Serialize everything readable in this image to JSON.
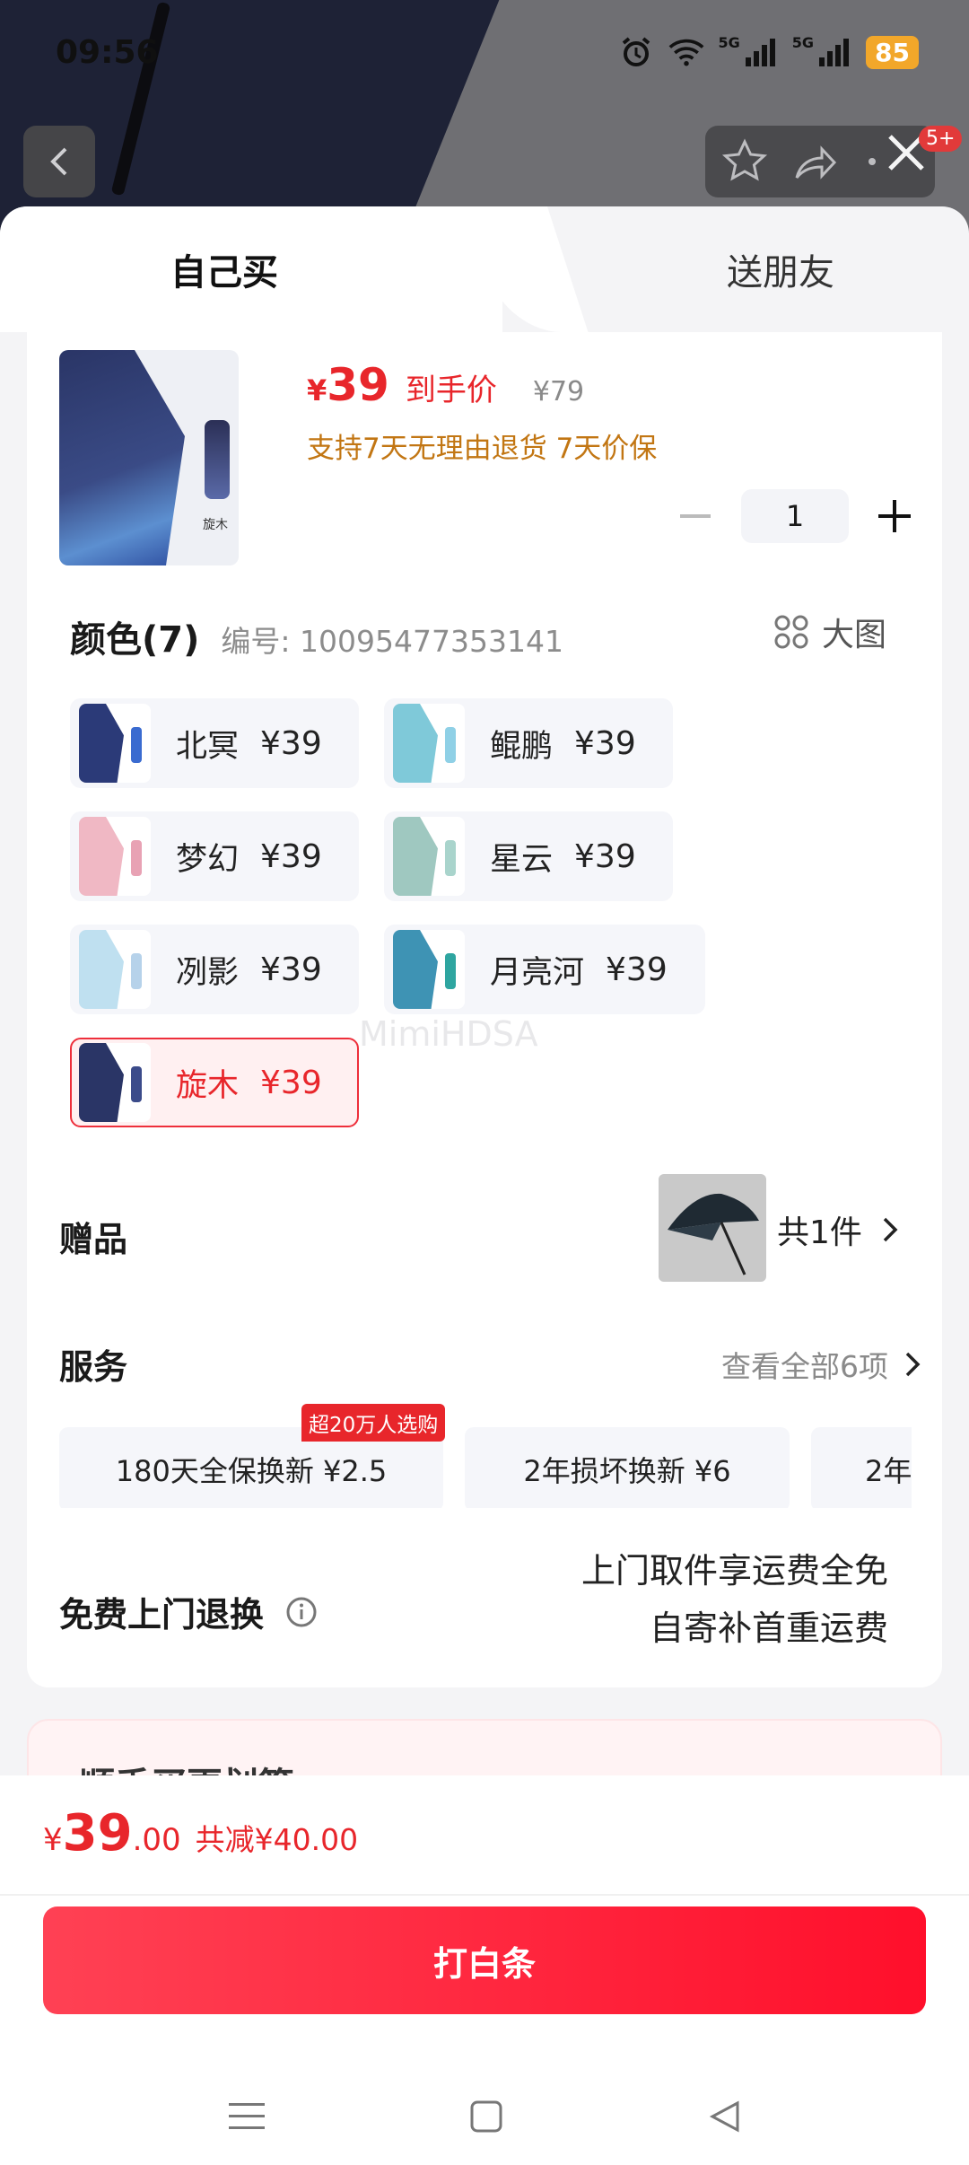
{
  "status_bar": {
    "time": "09:56",
    "signal_1": "5G",
    "signal_2": "5G",
    "battery": "85"
  },
  "header": {
    "notification_badge": "5+"
  },
  "tabs": {
    "self": "自己买",
    "friend": "送朋友"
  },
  "product": {
    "price_currency": "¥",
    "price": "39",
    "price_tag": "到手价",
    "original_price": "¥79",
    "promise": "支持7天无理由退货 7天价保",
    "image_label": "旋木",
    "quantity": "1"
  },
  "color_section": {
    "title": "颜色(7)",
    "code": "编号: 10095477353141",
    "big_image": "大图",
    "options": [
      {
        "label": "北冥",
        "price": "¥39",
        "color_a": "#2b3a78",
        "color_b": "#3a6bd0"
      },
      {
        "label": "鲲鹏",
        "price": "¥39",
        "color_a": "#7fc9d9",
        "color_b": "#8fd0e6"
      },
      {
        "label": "梦幻",
        "price": "¥39",
        "color_a": "#f0b8c4",
        "color_b": "#e8a2b4"
      },
      {
        "label": "星云",
        "price": "¥39",
        "color_a": "#9fc8c0",
        "color_b": "#a9d4cc"
      },
      {
        "label": "冽影",
        "price": "¥39",
        "color_a": "#bfe0f0",
        "color_b": "#b6d2ea"
      },
      {
        "label": "月亮河",
        "price": "¥39",
        "color_a": "#3e93b4",
        "color_b": "#2ea5a0"
      },
      {
        "label": "旋木",
        "price": "¥39",
        "color_a": "#2a3566",
        "color_b": "#3b4b8a"
      }
    ]
  },
  "watermark": "MimiHDSA",
  "gift": {
    "title": "赠品",
    "count": "共1件"
  },
  "service": {
    "title": "服务",
    "view_all": "查看全部6项",
    "badge": "超20万人选购",
    "cards": [
      "180天全保换新 ¥2.5",
      "2年损坏换新 ¥6",
      "2年"
    ]
  },
  "free_return": {
    "title": "免费上门退换",
    "line1": "上门取件享运费全免",
    "line2": "自寄补首重运费"
  },
  "promo": {
    "title": "顺手买更划算"
  },
  "bottom": {
    "currency": "¥",
    "total_int": "39",
    "total_dec": ".00",
    "saving": "共减¥40.00",
    "pay_label": "打白条"
  },
  "colors": {
    "accent": "#e8262b",
    "promise": "#c27613",
    "pay_button": "#ff1f3a"
  }
}
